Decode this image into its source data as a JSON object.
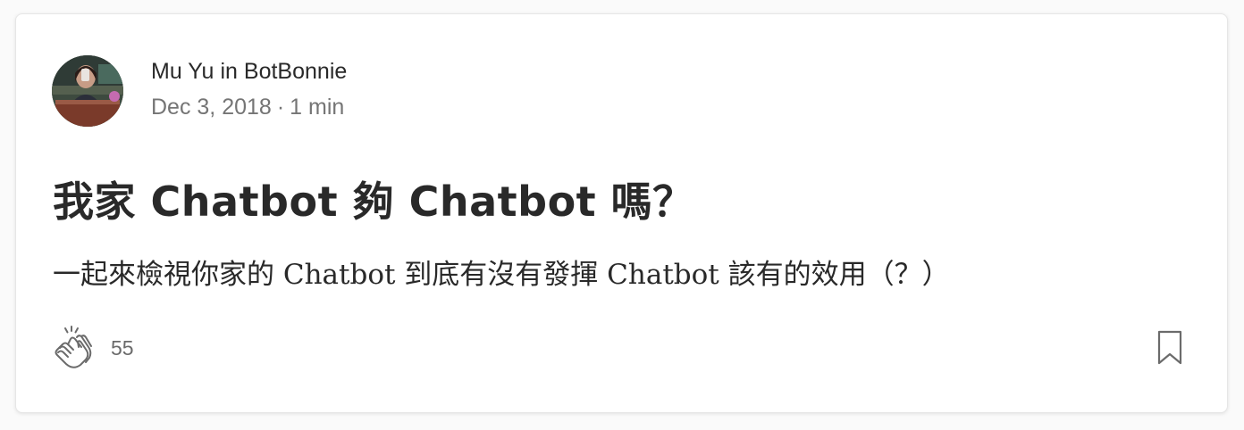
{
  "author": {
    "name": "Mu Yu",
    "connector": "in",
    "publication": "BotBonnie"
  },
  "post": {
    "date": "Dec 3, 2018",
    "separator": "·",
    "read_time": "1 min",
    "title": "我家 Chatbot 夠 Chatbot 嗎？",
    "subtitle": "一起來檢視你家的 Chatbot 到底有沒有發揮 Chatbot 該有的效用（？）"
  },
  "actions": {
    "clap_count": "55",
    "clap_icon": "clap-icon",
    "bookmark_icon": "bookmark-icon"
  },
  "colors": {
    "text_primary": "#292929",
    "text_secondary": "#757575",
    "card_border": "#e6e6e6"
  }
}
